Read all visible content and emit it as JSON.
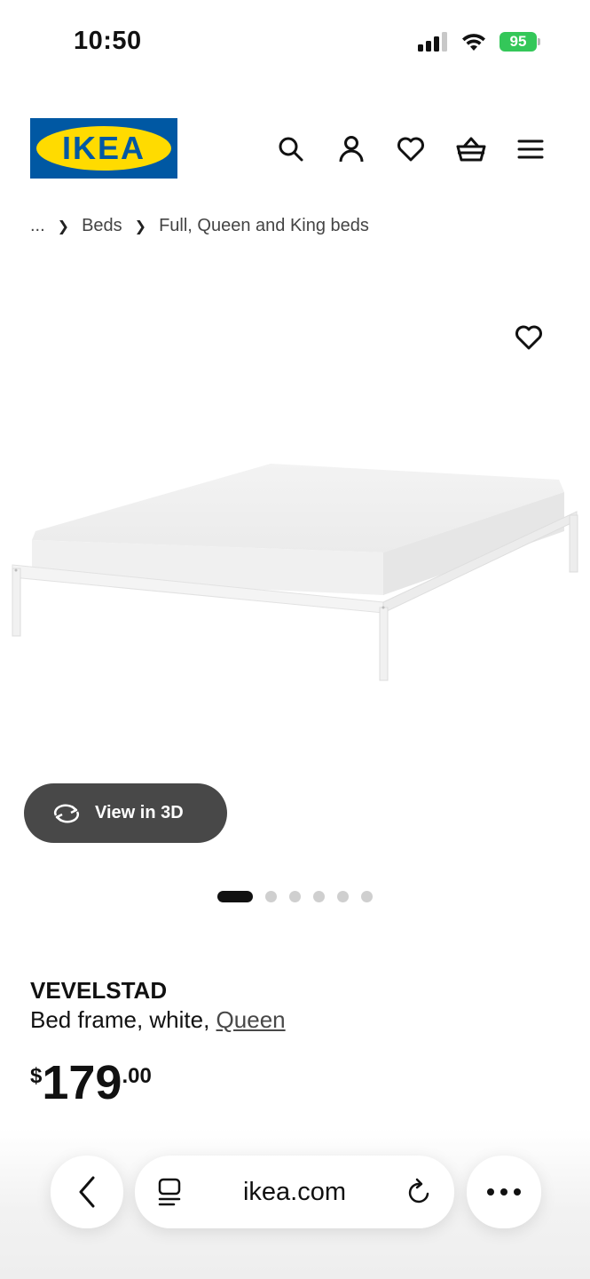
{
  "status_bar": {
    "time": "10:50",
    "battery": "95",
    "battery_color": "#34c759"
  },
  "header": {
    "logo_text": "IKEA",
    "logo_colors": {
      "blue": "#0058a3",
      "yellow": "#ffdb00"
    },
    "icons": [
      "search-icon",
      "account-icon",
      "favourites-icon",
      "cart-icon",
      "menu-icon"
    ]
  },
  "breadcrumb": {
    "items": [
      "...",
      "Beds",
      "Full, Queen and King beds"
    ]
  },
  "gallery": {
    "view3d_label": "View in 3D",
    "slide_count": 6,
    "active_slide": 1
  },
  "product": {
    "name": "VEVELSTAD",
    "description": "Bed frame, white, ",
    "variant": "Queen",
    "price": {
      "currency": "$",
      "integer": "179",
      "decimal": ".00"
    }
  },
  "browser": {
    "url": "ikea.com"
  }
}
